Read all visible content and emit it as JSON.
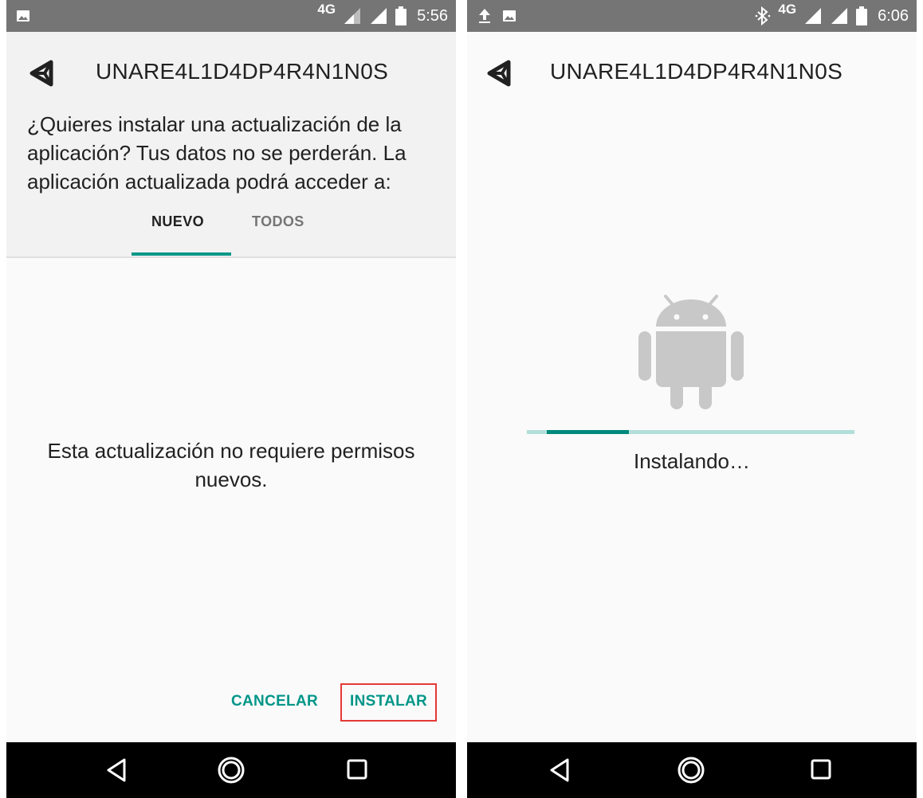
{
  "colors": {
    "status_bar": "#757575",
    "accent": "#009688",
    "highlight": "#e53935",
    "nav_bar": "#000000",
    "android_icon": "#c8c8c8",
    "progress_track": "#b2dfdb",
    "progress_fill": "#00897b"
  },
  "left": {
    "status_bar": {
      "left_icons": [
        "image-notification-icon"
      ],
      "network": "4G",
      "right_icons": [
        "signal-icon",
        "signal-icon",
        "battery-icon"
      ],
      "time": "5:56"
    },
    "app_icon": "unity-icon",
    "app_title": "UNARE4L1D4DP4R4N1N0S",
    "prompt": "¿Quieres instalar una actualización de la aplicación? Tus datos no se perderán. La aplicación actualizada podrá acceder a:",
    "tabs": [
      {
        "label": "NUEVO",
        "selected": true
      },
      {
        "label": "TODOS",
        "selected": false
      }
    ],
    "message": "Esta actualización no requiere permisos nuevos.",
    "buttons": {
      "cancel": "CANCELAR",
      "install": "INSTALAR"
    },
    "nav_icons": [
      "back-icon",
      "home-icon",
      "recents-icon"
    ]
  },
  "right": {
    "status_bar": {
      "left_icons": [
        "upload-icon",
        "image-notification-icon"
      ],
      "network": "4G",
      "right_icons": [
        "bluetooth-icon",
        "signal-icon",
        "signal-icon",
        "battery-icon"
      ],
      "time": "6:06"
    },
    "app_icon": "unity-icon",
    "app_title": "UNARE4L1D4DP4R4N1N0S",
    "progress_fraction": 0.25,
    "status_text": "Instalando…",
    "nav_icons": [
      "back-icon",
      "home-icon",
      "recents-icon"
    ]
  }
}
